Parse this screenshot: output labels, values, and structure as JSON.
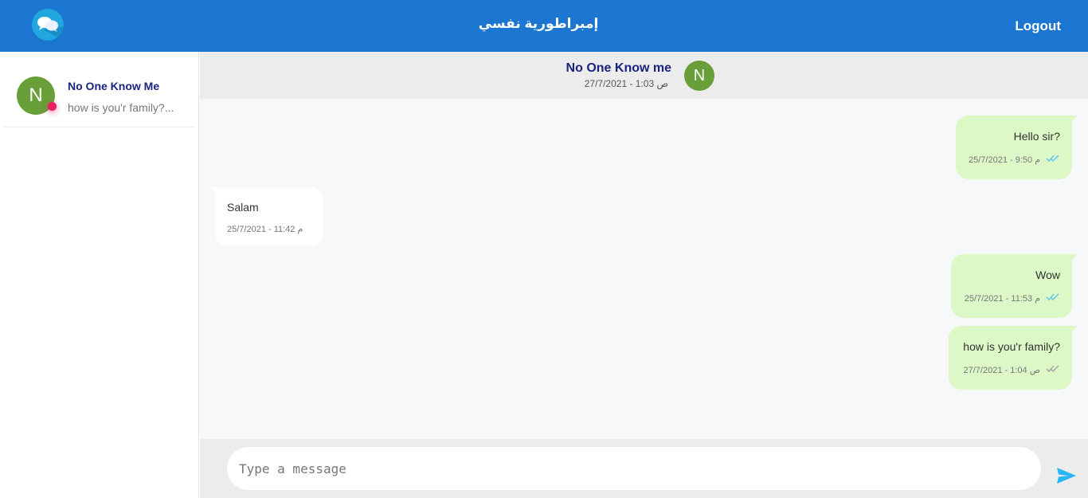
{
  "header": {
    "title": "إمبراطورية نفسي",
    "logout_label": "Logout",
    "accent_color": "#1b76d2"
  },
  "sidebar": {
    "conversations": [
      {
        "avatar_letter": "N",
        "name": "No One Know Me",
        "preview": "how is you'r family?...",
        "status_color": "#e91e63"
      }
    ]
  },
  "chat": {
    "contact_name": "No One Know me",
    "contact_time": "27/7/2021 - 1:03 ص",
    "avatar_letter": "N",
    "messages": [
      {
        "direction": "out",
        "text": "Hello sir?",
        "time": "25/7/2021 - 9:50 م",
        "read": true
      },
      {
        "direction": "in",
        "text": "Salam",
        "time": "25/7/2021 - 11:42 م"
      },
      {
        "direction": "out",
        "text": "Wow",
        "time": "25/7/2021 - 11:53 م",
        "read": true
      },
      {
        "direction": "out",
        "text": "how is you'r family?",
        "time": "27/7/2021 - 1:04 ص",
        "read": false
      }
    ]
  },
  "composer": {
    "placeholder": "Type a message",
    "value": ""
  },
  "icons": {
    "logo": "chat-bubbles-icon",
    "send": "send-icon",
    "read": "double-check-icon"
  }
}
